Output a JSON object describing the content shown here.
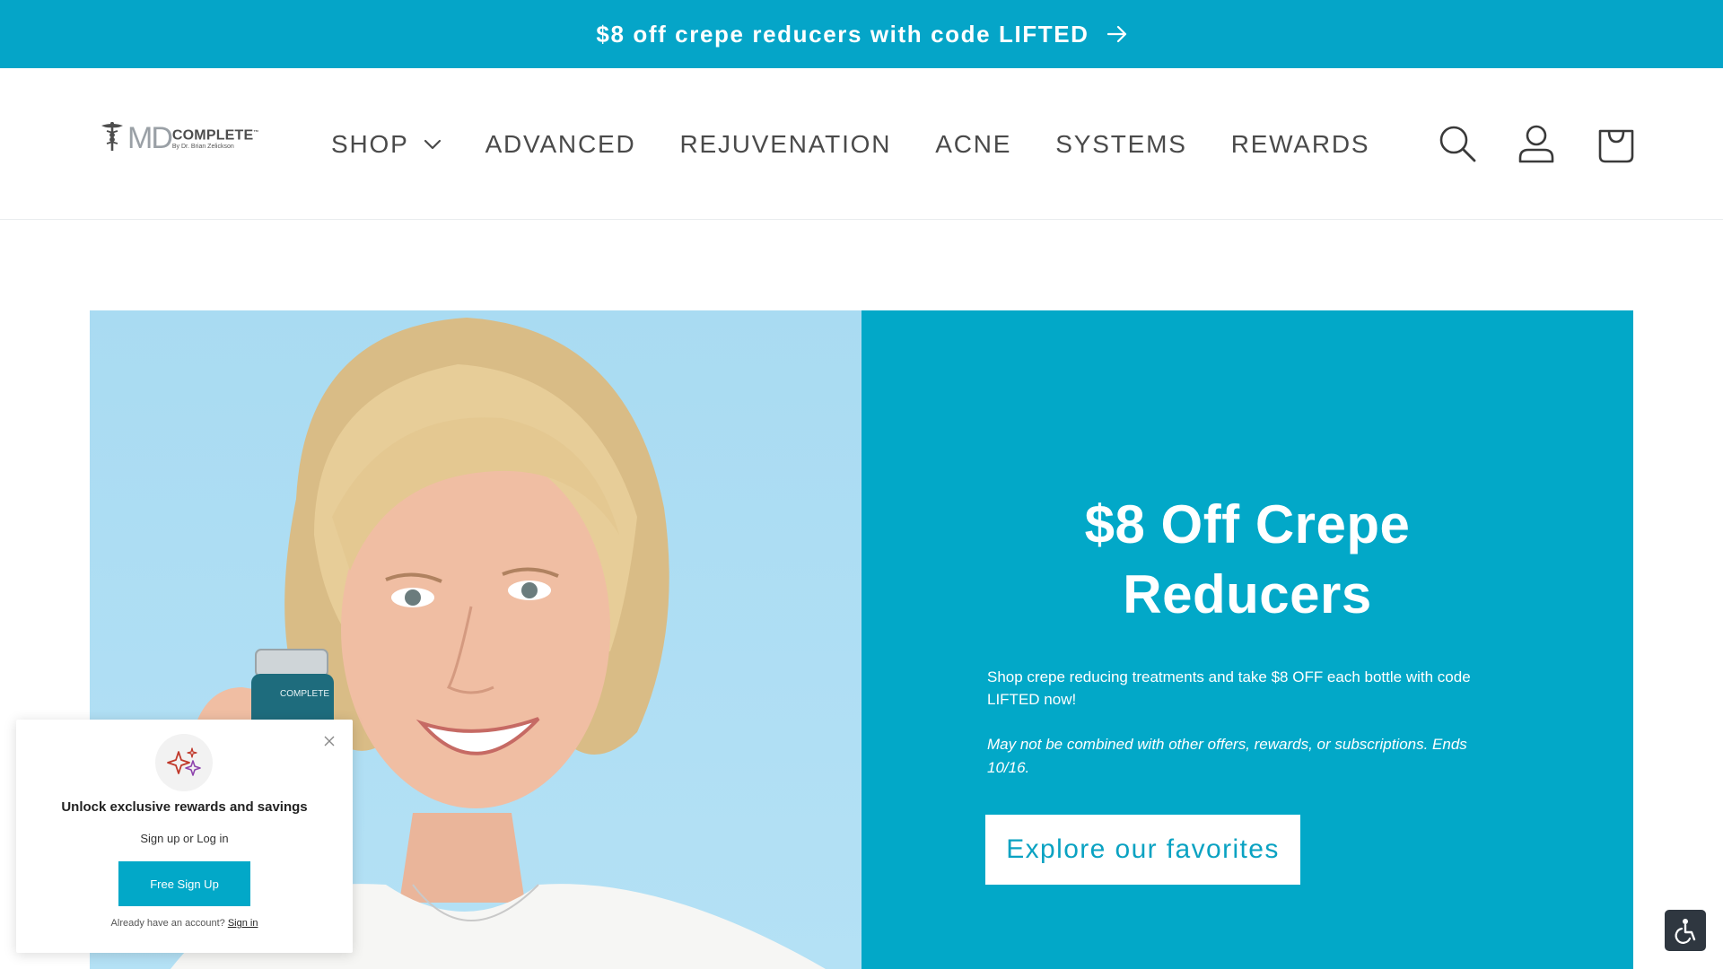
{
  "announcement": {
    "text": "$8 off crepe reducers with code LIFTED",
    "arrow_icon": "arrow-right-icon",
    "bg_color": "#05a5c8"
  },
  "header": {
    "logo": {
      "md": "MD",
      "word": "COMPLETE",
      "tm": "™",
      "byline": "By Dr. Brian Zelickson"
    },
    "nav": [
      {
        "label": "SHOP",
        "has_dropdown": true
      },
      {
        "label": "ADVANCED"
      },
      {
        "label": "REJUVENATION"
      },
      {
        "label": "ACNE"
      },
      {
        "label": "SYSTEMS"
      },
      {
        "label": "REWARDS"
      }
    ],
    "icons": [
      "search-icon",
      "account-icon",
      "cart-icon"
    ]
  },
  "hero": {
    "title_line1": "$8 Off Crepe",
    "title_line2": "Reducers",
    "description": "Shop crepe reducing treatments and take $8 OFF each bottle with code LIFTED now!",
    "note": "May not be combined with other offers, rewards, or subscriptions. Ends 10/16.",
    "button_label": "Explore our favorites",
    "panel_color": "#02a8c8",
    "image_jar_text": "COMPLETE"
  },
  "rewards_popup": {
    "title": "Unlock exclusive rewards and savings",
    "subtitle": "Sign up or Log in",
    "button_label": "Free Sign Up",
    "footer_text": "Already have an account?",
    "footer_link": "Sign in",
    "icon": "sparkles-icon"
  },
  "accessibility": {
    "icon": "accessibility-icon"
  }
}
